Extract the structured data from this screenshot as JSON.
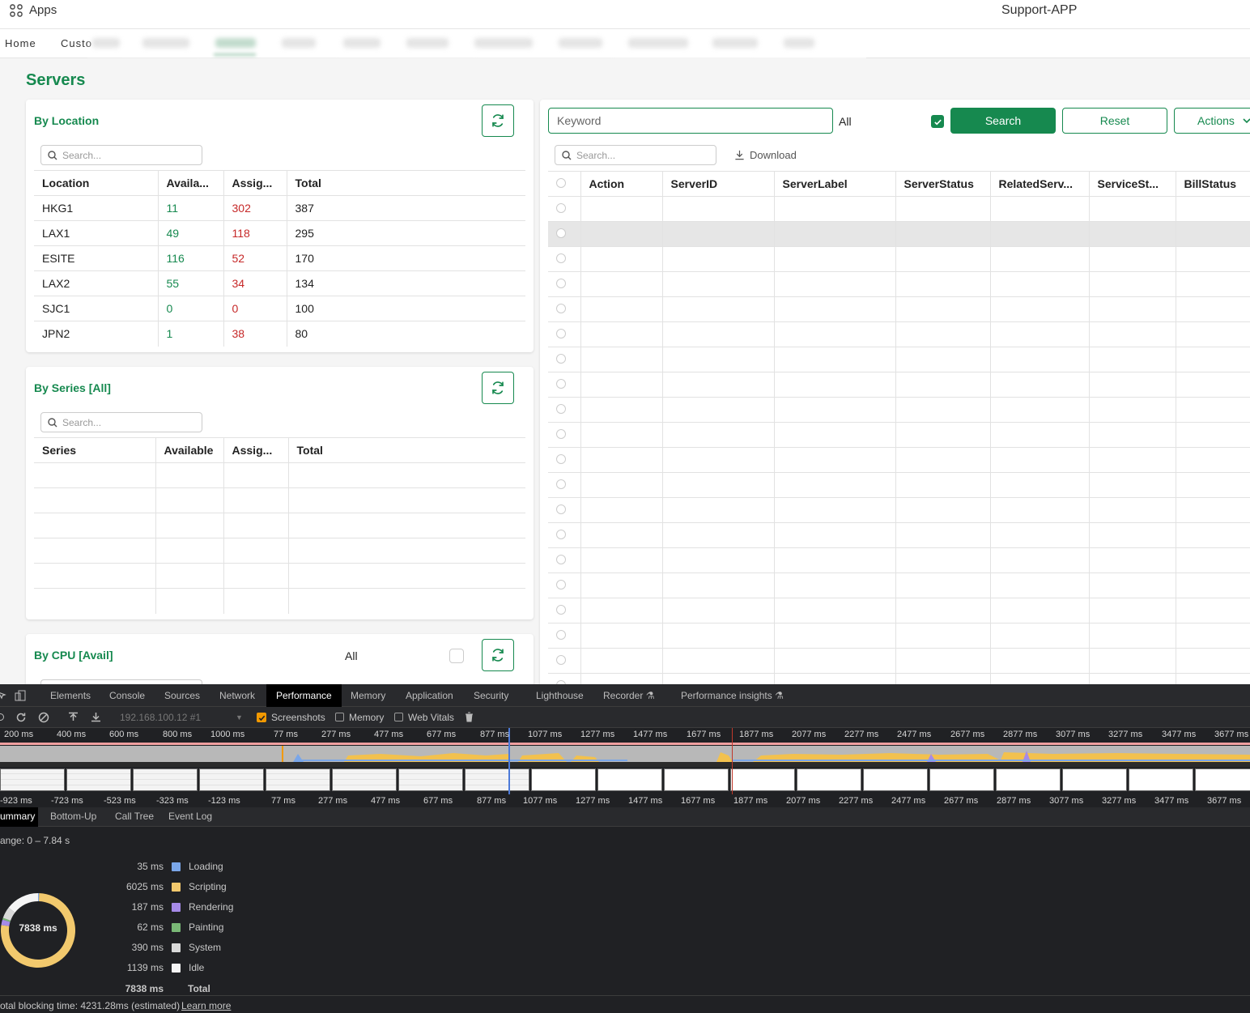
{
  "topbar": {
    "apps_label": "Apps",
    "app_title": "Support-APP"
  },
  "nav": {
    "home": "Home",
    "customers": "Custo"
  },
  "page": {
    "title": "Servers"
  },
  "by_location": {
    "title": "By Location",
    "search_placeholder": "Search...",
    "columns": [
      "Location",
      "Availa...",
      "Assig...",
      "Total"
    ],
    "rows": [
      [
        "HKG1",
        "11",
        "302",
        "387"
      ],
      [
        "LAX1",
        "49",
        "118",
        "295"
      ],
      [
        "ESITE",
        "116",
        "52",
        "170"
      ],
      [
        "LAX2",
        "55",
        "34",
        "134"
      ],
      [
        "SJC1",
        "0",
        "0",
        "100"
      ],
      [
        "JPN2",
        "1",
        "38",
        "80"
      ]
    ]
  },
  "by_series": {
    "title": "By Series [All]",
    "search_placeholder": "Search...",
    "columns": [
      "Series",
      "Available",
      "Assig...",
      "Total"
    ]
  },
  "by_cpu": {
    "title": "By CPU [Avail]",
    "filter": "All"
  },
  "server_search": {
    "keyword_placeholder": "Keyword",
    "filter": "All",
    "search_button": "Search",
    "reset_button": "Reset",
    "actions_button": "Actions",
    "table_search_placeholder": "Search...",
    "download": "Download",
    "columns": [
      "Action",
      "ServerID",
      "ServerLabel",
      "ServerStatus",
      "RelatedServ...",
      "ServiceSt...",
      "BillStatus"
    ]
  },
  "devtools": {
    "tabs": [
      "Elements",
      "Console",
      "Sources",
      "Network",
      "Performance",
      "Memory",
      "Application",
      "Security",
      "Lighthouse",
      "Recorder",
      "Performance insights"
    ],
    "active_tab": "Performance",
    "target": "192.168.100.12 #1",
    "screenshots": "Screenshots",
    "memory": "Memory",
    "web_vitals": "Web Vitals",
    "overview_ticks": [
      "200 ms",
      "400 ms",
      "600 ms",
      "800 ms",
      "1000 ms",
      "77 ms",
      "277 ms",
      "477 ms",
      "677 ms",
      "877 ms",
      "1077 ms",
      "1277 ms",
      "1477 ms",
      "1677 ms",
      "1877 ms",
      "2077 ms",
      "2277 ms",
      "2477 ms",
      "2677 ms",
      "2877 ms",
      "3077 ms",
      "3277 ms",
      "3477 ms",
      "3677 ms"
    ],
    "detail_ticks": [
      "-923 ms",
      "-723 ms",
      "-523 ms",
      "-323 ms",
      "-123 ms",
      "77 ms",
      "277 ms",
      "477 ms",
      "677 ms",
      "877 ms",
      "1077 ms",
      "1277 ms",
      "1477 ms",
      "1677 ms",
      "1877 ms",
      "2077 ms",
      "2277 ms",
      "2477 ms",
      "2677 ms",
      "2877 ms",
      "3077 ms",
      "3277 ms",
      "3477 ms",
      "3677 ms"
    ],
    "summary_tabs": [
      "ummary",
      "Bottom-Up",
      "Call Tree",
      "Event Log"
    ],
    "range": "ange: 0 – 7.84 s",
    "donut_total": "7838 ms",
    "legend": [
      {
        "value": "35 ms",
        "name": "Loading",
        "color": "#7aa6e8"
      },
      {
        "value": "6025 ms",
        "name": "Scripting",
        "color": "#f2c96d"
      },
      {
        "value": "187 ms",
        "name": "Rendering",
        "color": "#a68ae8"
      },
      {
        "value": "62 ms",
        "name": "Painting",
        "color": "#79b876"
      },
      {
        "value": "390 ms",
        "name": "System",
        "color": "#d9d9d9"
      },
      {
        "value": "1139 ms",
        "name": "Idle",
        "color": "#f5f5f5"
      }
    ],
    "total_value": "7838 ms",
    "total_label": "Total",
    "footer_text": "otal blocking time: 4231.28ms (estimated)",
    "footer_link": "Learn more"
  },
  "colors": {
    "accent": "#16894f",
    "assigned": "#c62828"
  }
}
